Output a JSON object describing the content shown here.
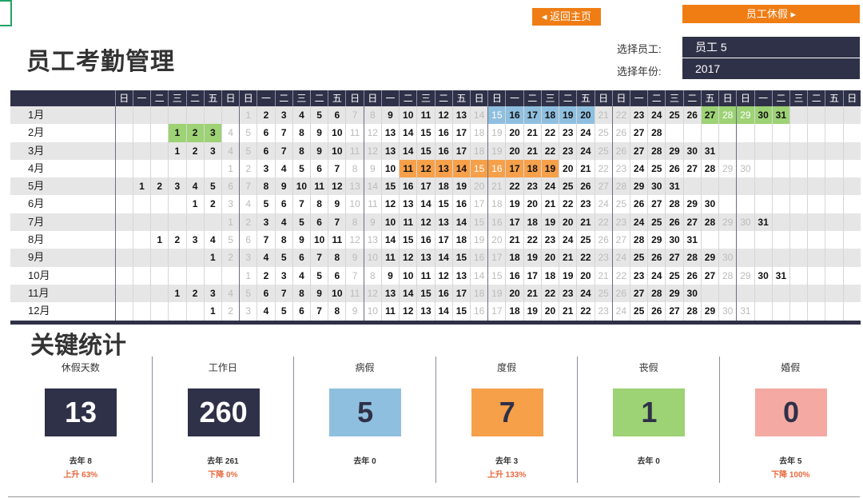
{
  "nav": {
    "home_label": "◂ 返回主页",
    "leave_label": "员工休假 ▸"
  },
  "page": {
    "title": "员工考勤管理"
  },
  "selectors": {
    "employee_label": "选择员工:",
    "employee_value": "员工 5",
    "year_label": "选择年份:",
    "year_value": "2017"
  },
  "calendar": {
    "weekday_headers": [
      "日",
      "一",
      "二",
      "三",
      "二",
      "五",
      "日",
      "日",
      "一",
      "二",
      "三",
      "二",
      "五",
      "日",
      "日",
      "一",
      "二",
      "三",
      "二",
      "五",
      "日",
      "日",
      "一",
      "二",
      "三",
      "二",
      "五",
      "日",
      "日",
      "一",
      "二",
      "三",
      "二",
      "五",
      "日",
      "日",
      "一",
      "二",
      "三",
      "二",
      "五",
      "日"
    ],
    "months": [
      "1月",
      "2月",
      "3月",
      "4月",
      "5月",
      "6月",
      "7月",
      "8月",
      "9月",
      "10月",
      "11月",
      "12月"
    ],
    "start_offsets": [
      7,
      3,
      3,
      6,
      1,
      4,
      6,
      2,
      5,
      7,
      3,
      5
    ],
    "month_days": [
      31,
      28,
      31,
      30,
      31,
      30,
      31,
      31,
      30,
      31,
      30,
      31
    ],
    "weekend_columns": [
      0,
      6,
      7,
      13,
      14,
      20,
      21,
      27,
      28,
      34,
      35,
      41
    ],
    "sick_days": [
      {
        "month": 1,
        "days": [
          15,
          16,
          17,
          18,
          19,
          20
        ]
      }
    ],
    "vacation_days": [
      {
        "month": 4,
        "days": [
          11,
          12,
          13,
          14,
          15,
          16,
          17,
          18,
          19
        ]
      }
    ],
    "personal_days": [
      {
        "month": 1,
        "days": [
          27,
          28,
          29,
          30,
          31
        ]
      },
      {
        "month": 2,
        "days": [
          1,
          2,
          3
        ]
      }
    ],
    "colors": {
      "sick": "#8fbfdf",
      "vacation": "#f6a04a",
      "personal": "#9dd275",
      "header": "#2f3148"
    }
  },
  "stats": {
    "title": "关键统计",
    "items": [
      {
        "label": "休假天数",
        "value": "13",
        "last": "去年 8",
        "change": "上升 63%",
        "box_color": "#2f3148",
        "text_color": "#ffffff"
      },
      {
        "label": "工作日",
        "value": "260",
        "last": "去年 261",
        "change": "下降 0%",
        "box_color": "#2f3148",
        "text_color": "#ffffff"
      },
      {
        "label": "病假",
        "value": "5",
        "last": "去年 0",
        "change": "",
        "box_color": "#8fbfdf",
        "text_color": "#2f3148"
      },
      {
        "label": "度假",
        "value": "7",
        "last": "去年 3",
        "change": "上升 133%",
        "box_color": "#f6a04a",
        "text_color": "#2f3148"
      },
      {
        "label": "丧假",
        "value": "1",
        "last": "去年 0",
        "change": "",
        "box_color": "#9dd275",
        "text_color": "#2f3148"
      },
      {
        "label": "婚假",
        "value": "0",
        "last": "去年 5",
        "change": "下降 100%",
        "box_color": "#f4aaa2",
        "text_color": "#2f3148"
      }
    ]
  }
}
